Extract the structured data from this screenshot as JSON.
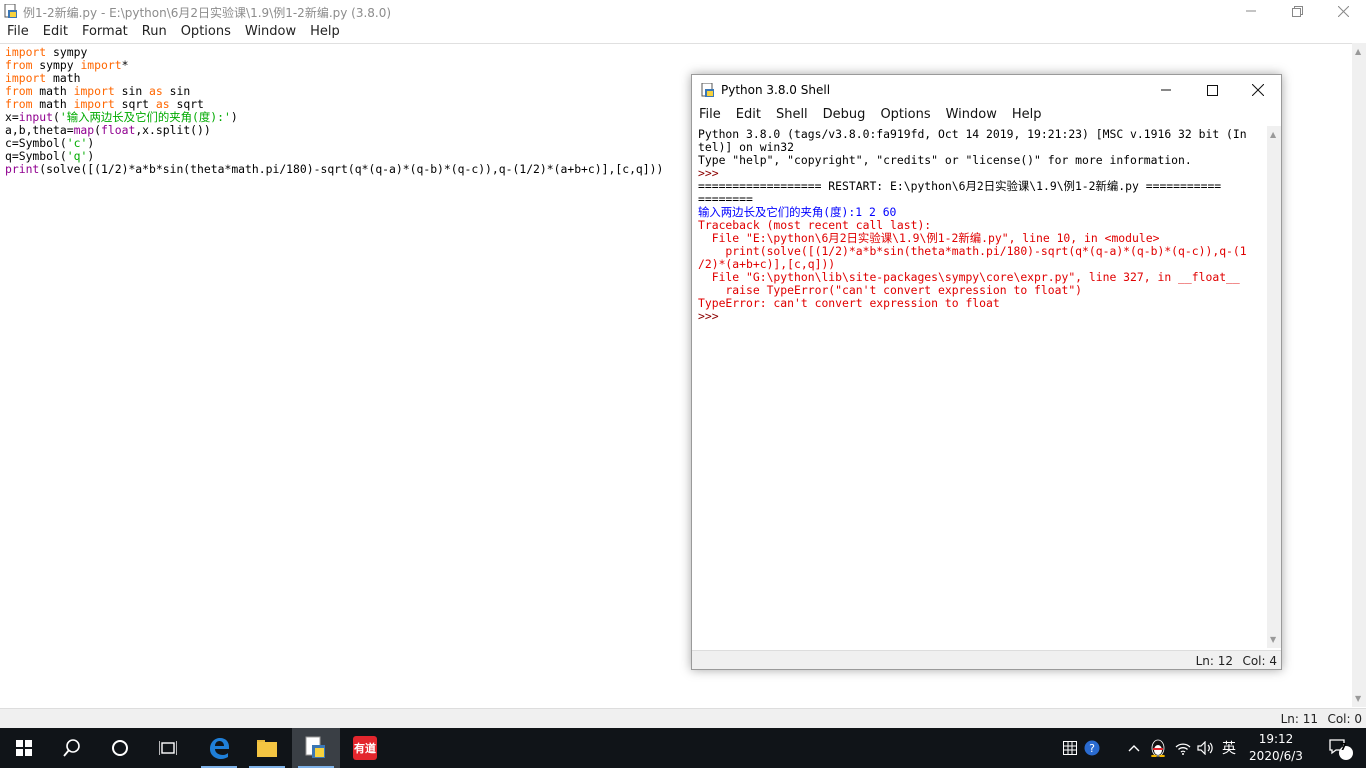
{
  "editor": {
    "title": "例1-2新编.py - E:\\python\\6月2日实验课\\1.9\\例1-2新编.py (3.8.0)",
    "menu": [
      "File",
      "Edit",
      "Format",
      "Run",
      "Options",
      "Window",
      "Help"
    ],
    "code_lines": [
      [
        {
          "t": "import",
          "c": "kw"
        },
        {
          "t": " sympy",
          "c": ""
        }
      ],
      [
        {
          "t": "from",
          "c": "kw"
        },
        {
          "t": " sympy ",
          "c": ""
        },
        {
          "t": "import",
          "c": "kw"
        },
        {
          "t": "*",
          "c": ""
        }
      ],
      [
        {
          "t": "import",
          "c": "kw"
        },
        {
          "t": " math",
          "c": ""
        }
      ],
      [
        {
          "t": "from",
          "c": "kw"
        },
        {
          "t": " math ",
          "c": ""
        },
        {
          "t": "import",
          "c": "kw"
        },
        {
          "t": " sin ",
          "c": ""
        },
        {
          "t": "as",
          "c": "kw"
        },
        {
          "t": " sin",
          "c": ""
        }
      ],
      [
        {
          "t": "from",
          "c": "kw"
        },
        {
          "t": " math ",
          "c": ""
        },
        {
          "t": "import",
          "c": "kw"
        },
        {
          "t": " sqrt ",
          "c": ""
        },
        {
          "t": "as",
          "c": "kw"
        },
        {
          "t": " sqrt",
          "c": ""
        }
      ],
      [
        {
          "t": "x=",
          "c": ""
        },
        {
          "t": "input",
          "c": "bi"
        },
        {
          "t": "(",
          "c": ""
        },
        {
          "t": "'输入两边长及它们的夹角(度):'",
          "c": "str"
        },
        {
          "t": ")",
          "c": ""
        }
      ],
      [
        {
          "t": "a,b,theta=",
          "c": ""
        },
        {
          "t": "map",
          "c": "bi"
        },
        {
          "t": "(",
          "c": ""
        },
        {
          "t": "float",
          "c": "bi"
        },
        {
          "t": ",x.split())",
          "c": ""
        }
      ],
      [
        {
          "t": "c=Symbol(",
          "c": ""
        },
        {
          "t": "'c'",
          "c": "str"
        },
        {
          "t": ")",
          "c": ""
        }
      ],
      [
        {
          "t": "q=Symbol(",
          "c": ""
        },
        {
          "t": "'q'",
          "c": "str"
        },
        {
          "t": ")",
          "c": ""
        }
      ],
      [
        {
          "t": "print",
          "c": "bi"
        },
        {
          "t": "(solve([(1/2)*a*b*sin(theta*math.pi/180)-sqrt(q*(q-a)*(q-b)*(q-c)),q-(1/2)*(a+b+c)],[c,q]))",
          "c": ""
        }
      ]
    ],
    "status": {
      "ln": "Ln: 11",
      "col": "Col: 0"
    }
  },
  "shell": {
    "title": "Python 3.8.0 Shell",
    "menu": [
      "File",
      "Edit",
      "Shell",
      "Debug",
      "Options",
      "Window",
      "Help"
    ],
    "lines": [
      {
        "t": "Python 3.8.0 (tags/v3.8.0:fa919fd, Oct 14 2019, 19:21:23) [MSC v.1916 32 bit (In",
        "c": "out"
      },
      {
        "t": "tel)] on win32",
        "c": "out"
      },
      {
        "t": "Type \"help\", \"copyright\", \"credits\" or \"license()\" for more information.",
        "c": "out"
      },
      {
        "t": ">>> ",
        "c": "prompt"
      },
      {
        "t": "================== RESTART: E:\\python\\6月2日实验课\\1.9\\例1-2新编.py ===========",
        "c": "out"
      },
      {
        "t": "========",
        "c": "out"
      },
      {
        "t": "输入两边长及它们的夹角(度):1 2 60",
        "c": "blue"
      },
      {
        "t": "Traceback (most recent call last):",
        "c": "red"
      },
      {
        "t": "  File \"E:\\python\\6月2日实验课\\1.9\\例1-2新编.py\", line 10, in <module>",
        "c": "red"
      },
      {
        "t": "    print(solve([(1/2)*a*b*sin(theta*math.pi/180)-sqrt(q*(q-a)*(q-b)*(q-c)),q-(1",
        "c": "red"
      },
      {
        "t": "/2)*(a+b+c)],[c,q]))",
        "c": "red"
      },
      {
        "t": "  File \"G:\\python\\lib\\site-packages\\sympy\\core\\expr.py\", line 327, in __float__",
        "c": "red"
      },
      {
        "t": "    raise TypeError(\"can't convert expression to float\")",
        "c": "red"
      },
      {
        "t": "TypeError: can't convert expression to float",
        "c": "red"
      },
      {
        "t": ">>> ",
        "c": "prompt"
      }
    ],
    "status": {
      "ln": "Ln: 12",
      "col": "Col: 4"
    }
  },
  "taskbar": {
    "ime": "英",
    "time": "19:12",
    "date": "2020/6/3",
    "notification_count": "7",
    "youdao_label": "有道"
  }
}
